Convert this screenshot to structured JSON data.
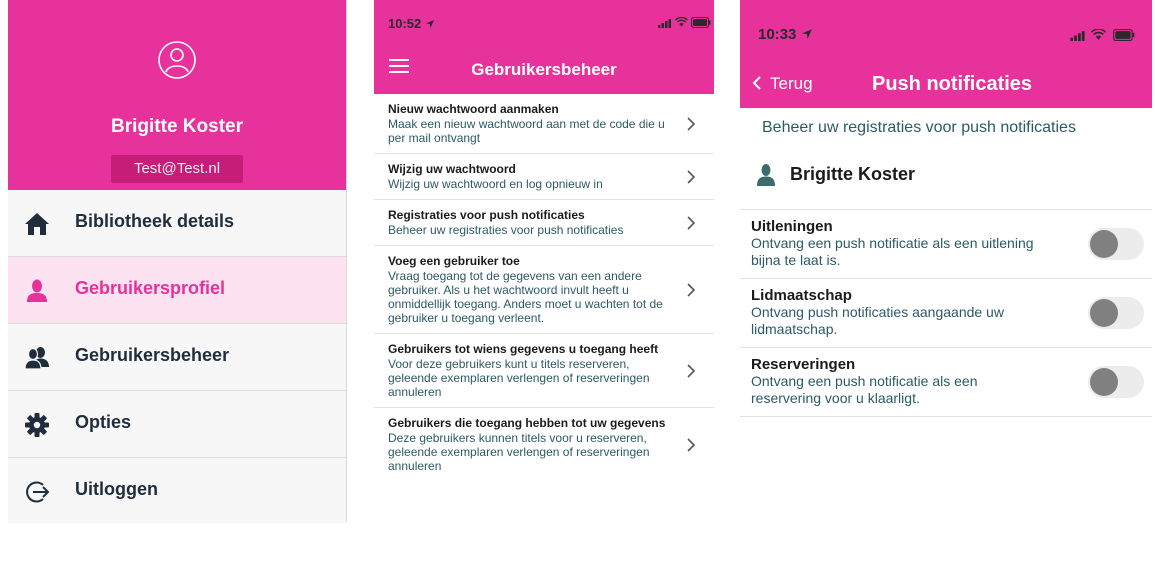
{
  "panel1": {
    "user_name": "Brigitte Koster",
    "email": "Test@Test.nl",
    "menu": [
      {
        "label": "Bibliotheek details",
        "icon": "home-icon"
      },
      {
        "label": "Gebruikersprofiel",
        "icon": "user-icon",
        "active": true
      },
      {
        "label": "Gebruikersbeheer",
        "icon": "users-icon"
      },
      {
        "label": "Opties",
        "icon": "gear-icon"
      },
      {
        "label": "Uitloggen",
        "icon": "logout-icon"
      }
    ]
  },
  "panel2": {
    "time": "10:52",
    "title": "Gebruikersbeheer",
    "items": [
      {
        "title": "Nieuw wachtwoord aanmaken",
        "description": "Maak een nieuw wachtwoord aan met de code die u per mail ontvangt"
      },
      {
        "title": "Wijzig uw wachtwoord",
        "description": "Wijzig uw wachtwoord en log opnieuw in"
      },
      {
        "title": "Registraties voor push notificaties",
        "description": "Beheer uw registraties voor push notificaties"
      },
      {
        "title": "Voeg een gebruiker toe",
        "description": "Vraag toegang tot de gegevens van een andere gebruiker. Als u het wachtwoord invult heeft u onmiddellijk toegang. Anders moet u wachten tot de gebruiker u toegang verleent."
      },
      {
        "title": "Gebruikers tot wiens gegevens u toegang heeft",
        "description": "Voor deze gebruikers kunt u titels reserveren, geleende exemplaren verlengen of reserveringen annuleren"
      },
      {
        "title": "Gebruikers die toegang hebben tot uw gegevens",
        "description": "Deze gebruikers kunnen titels voor u reserveren, geleende exemplaren verlengen of reserveringen annuleren"
      }
    ]
  },
  "panel3": {
    "time": "10:33",
    "back_label": "Terug",
    "title": "Push notificaties",
    "subtitle": "Beheer uw registraties voor push notificaties",
    "user_name": "Brigitte Koster",
    "options": [
      {
        "title": "Uitleningen",
        "description": "Ontvang een push notificatie als een uitlening bijna te laat is.",
        "enabled": false
      },
      {
        "title": "Lidmaatschap",
        "description": "Ontvang push notificaties aangaande uw lidmaatschap.",
        "enabled": false
      },
      {
        "title": "Reserveringen",
        "description": "Ontvang een push notificatie als een reservering voor u klaarligt.",
        "enabled": false
      }
    ]
  },
  "colors": {
    "brand": "#e6329a",
    "brand_dark": "#c51d78",
    "active_bg": "#fde3f1",
    "text_dark": "#1f2d3d",
    "text_teal": "#2c5a66",
    "toggle_off_knob": "#808080"
  }
}
